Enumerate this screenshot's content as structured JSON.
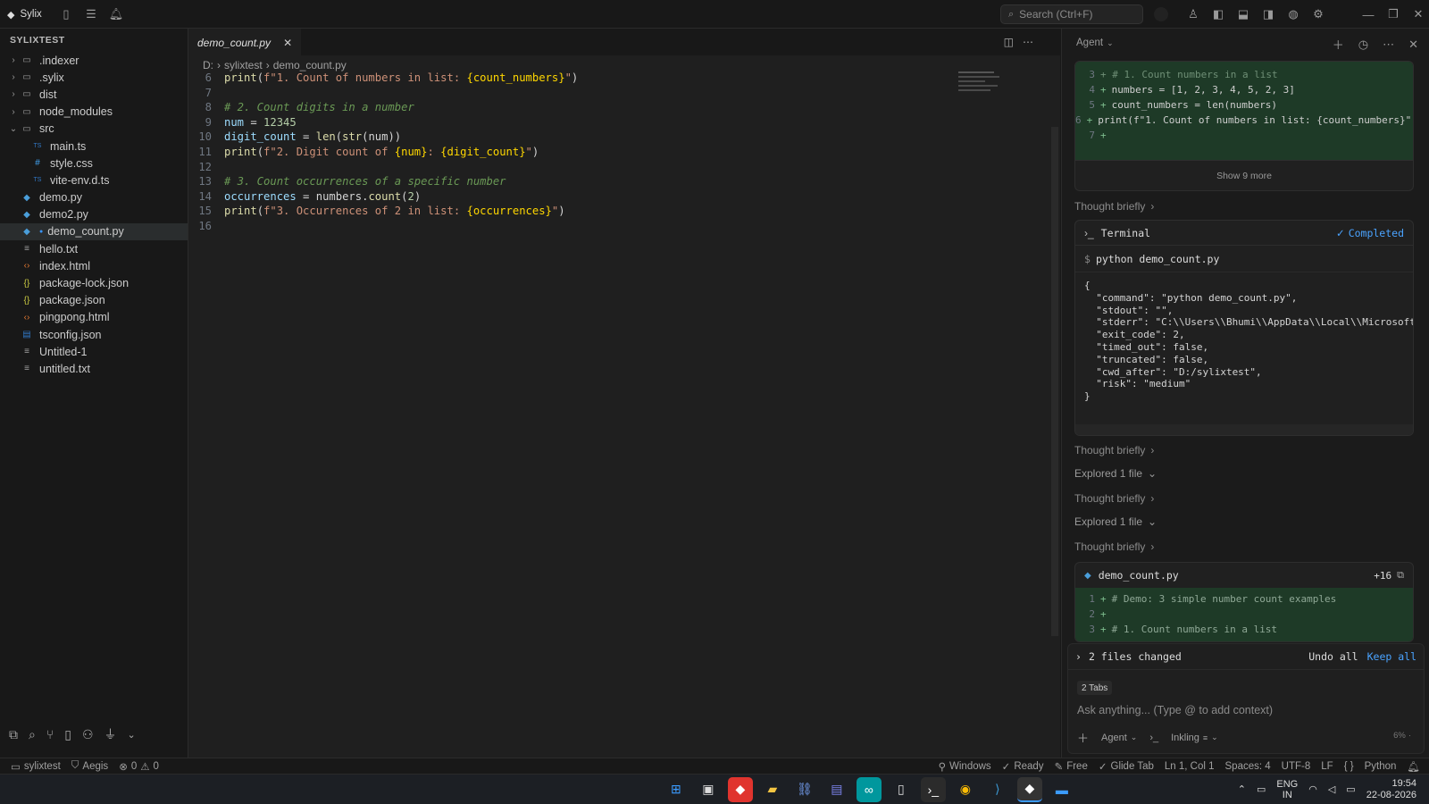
{
  "titlebar": {
    "app_name": "Sylix",
    "search_placeholder": "Search (Ctrl+F)"
  },
  "sidebar": {
    "title": "SYLIXTEST",
    "items": [
      {
        "label": ".indexer",
        "type": "folder",
        "indent": 0
      },
      {
        "label": ".sylix",
        "type": "folder",
        "indent": 0
      },
      {
        "label": "dist",
        "type": "folder",
        "indent": 0
      },
      {
        "label": "node_modules",
        "type": "folder",
        "indent": 0
      },
      {
        "label": "src",
        "type": "folder-open",
        "indent": 0
      },
      {
        "label": "main.ts",
        "type": "ts",
        "indent": 1
      },
      {
        "label": "style.css",
        "type": "css",
        "indent": 1
      },
      {
        "label": "vite-env.d.ts",
        "type": "ts",
        "indent": 1
      },
      {
        "label": "demo.py",
        "type": "py",
        "indent": 0
      },
      {
        "label": "demo2.py",
        "type": "py",
        "indent": 0
      },
      {
        "label": "demo_count.py",
        "type": "py",
        "indent": 0,
        "selected": true
      },
      {
        "label": "hello.txt",
        "type": "txt",
        "indent": 0
      },
      {
        "label": "index.html",
        "type": "html",
        "indent": 0
      },
      {
        "label": "package-lock.json",
        "type": "json",
        "indent": 0
      },
      {
        "label": "package.json",
        "type": "json",
        "indent": 0
      },
      {
        "label": "pingpong.html",
        "type": "html",
        "indent": 0
      },
      {
        "label": "tsconfig.json",
        "type": "tsjson",
        "indent": 0
      },
      {
        "label": "Untitled-1",
        "type": "txt",
        "indent": 0
      },
      {
        "label": "untitled.txt",
        "type": "txt",
        "indent": 0
      }
    ]
  },
  "editor": {
    "tab_label": "demo_count.py",
    "breadcrumb": [
      "D:",
      "sylixtest",
      "demo_count.py"
    ],
    "line_numbers": [
      "6",
      "7",
      "8",
      "9",
      "10",
      "11",
      "12",
      "13",
      "14",
      "15",
      "16"
    ]
  },
  "agent": {
    "header_label": "Agent",
    "top_diff": [
      {
        "n": "4",
        "code": "numbers = [1, 2, 3, 4, 5, 2, 3]"
      },
      {
        "n": "5",
        "code": "count_numbers = len(numbers)"
      },
      {
        "n": "6",
        "code": "print(f\"1. Count of numbers in list: {count_numbers}\")"
      },
      {
        "n": "7",
        "code": ""
      }
    ],
    "show_more": "Show 9 more",
    "thought_1": "Thought briefly",
    "terminal": {
      "title": "Terminal",
      "status": "Completed",
      "command": "python demo_count.py",
      "output": [
        "{",
        "  \"command\": \"python demo_count.py\",",
        "  \"stdout\": \"\",",
        "  \"stderr\": \"C:\\\\Users\\\\Bhumi\\\\AppData\\\\Local\\\\Microsoft\\\\W",
        "  \"exit_code\": 2,",
        "  \"timed_out\": false,",
        "  \"truncated\": false,",
        "  \"cwd_after\": \"D:/sylixtest\",",
        "  \"risk\": \"medium\"",
        "}"
      ]
    },
    "thought_2": "Thought briefly",
    "explored_1": "Explored 1 file",
    "thought_3": "Thought briefly",
    "explored_2": "Explored 1 file",
    "thought_4": "Thought briefly",
    "file_card": {
      "name": "demo_count.py",
      "added": "+16",
      "lines": [
        {
          "n": "1",
          "code": "# Demo: 3 simple number count examples"
        },
        {
          "n": "2",
          "code": ""
        },
        {
          "n": "3",
          "code": "# 1. Count numbers in a list"
        }
      ]
    },
    "files_changed": "2 files changed",
    "undo_all": "Undo all",
    "keep_all": "Keep all",
    "tabs_chip": "2 Tabs",
    "input_placeholder": "Ask anything... (Type @ to add context)",
    "mode_label": "Agent",
    "model_label": "Inkling",
    "usage_label": "6%"
  },
  "statusbar": {
    "workspace": "sylixtest",
    "aegis": "Aegis",
    "errors": "0",
    "warnings": "0",
    "os": "Windows",
    "ready": "Ready",
    "plan": "Free",
    "glide": "Glide Tab",
    "position": "Ln 1, Col 1",
    "spaces": "Spaces: 4",
    "encoding": "UTF-8",
    "eol": "LF",
    "braces": "{ }",
    "language": "Python"
  },
  "taskbar": {
    "lang_top": "ENG",
    "lang_bottom": "IN",
    "time": "19:54",
    "date": "22-08-2026"
  },
  "colors": {
    "accent": "#3794ff",
    "diff_added_bg": "#1e3a27",
    "completed": "#4aa3ff"
  }
}
